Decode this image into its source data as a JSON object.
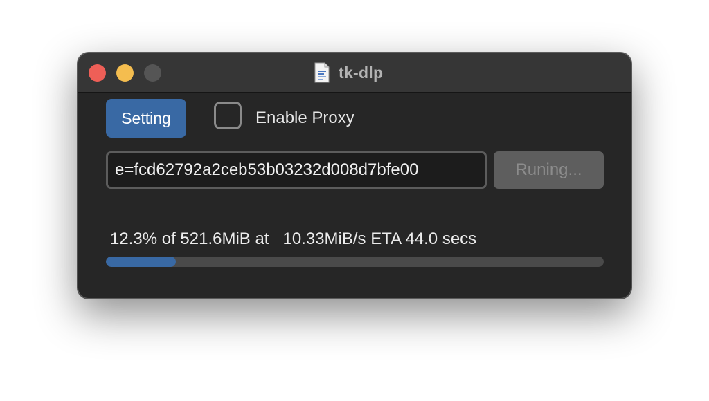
{
  "window": {
    "title": "tk-dlp"
  },
  "controls": {
    "setting_label": "Setting",
    "proxy_label": "Enable Proxy",
    "proxy_checked": false,
    "url_value": "e=fcd62792a2ceb53b03232d008d7bfe00",
    "run_label": "Runing..."
  },
  "progress": {
    "status_text": "12.3% of 521.6MiB at   10.33MiB/s ETA 44.0 secs",
    "fraction": 0.14
  },
  "colors": {
    "accent": "#3969a4",
    "close": "#ee5f57",
    "minimize": "#f4bd4f",
    "zoom_inactive": "#555555"
  },
  "icons": {
    "title_icon": "document-icon"
  }
}
